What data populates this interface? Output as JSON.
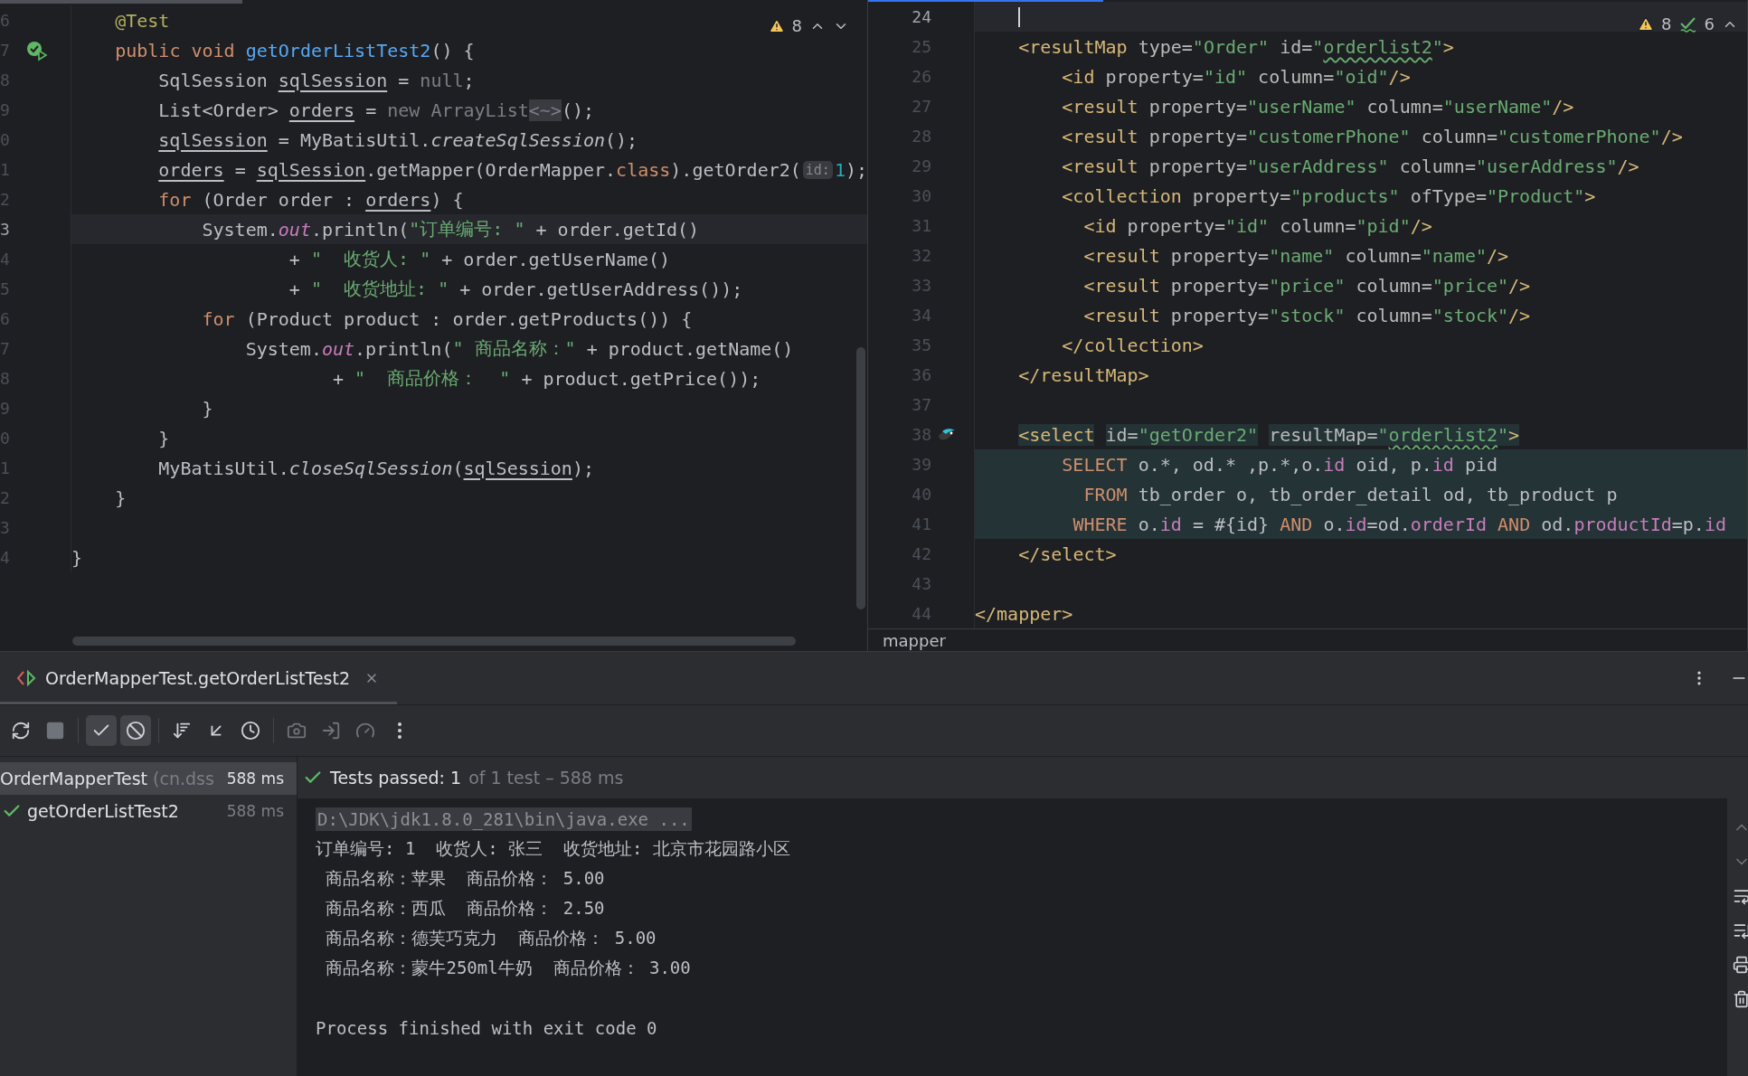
{
  "left_editor": {
    "focused": false,
    "inspections": {
      "warnings": "8"
    },
    "lines": [
      {
        "number": "6",
        "current": false,
        "tokens": [
          {
            "text": "    @Test",
            "kind": "annotation"
          }
        ]
      },
      {
        "number": "7",
        "current": false,
        "gutter_icon": {
          "kind": "run"
        },
        "tokens": [
          {
            "text": "    public void ",
            "kind": "keyword"
          },
          {
            "text": "getOrderListTest2",
            "kind": "decl"
          },
          {
            "text": "() {",
            "kind": "plain"
          }
        ]
      },
      {
        "number": "8",
        "current": false,
        "tokens": [
          {
            "text": "        SqlSession ",
            "kind": "plain"
          },
          {
            "text": "sqlSession",
            "kind": "var"
          },
          {
            "text": " = ",
            "kind": "plain"
          },
          {
            "text": "null",
            "kind": "dim"
          },
          {
            "text": ";",
            "kind": "plain"
          }
        ]
      },
      {
        "number": "9",
        "current": false,
        "tokens": [
          {
            "text": "        List<Order> ",
            "kind": "plain"
          },
          {
            "text": "orders",
            "kind": "var"
          },
          {
            "text": " = ",
            "kind": "plain"
          },
          {
            "text": "new ArrayList",
            "kind": "dim"
          },
          {
            "text": "<~>",
            "kind": "diamond"
          },
          {
            "text": "();",
            "kind": "plain"
          }
        ]
      },
      {
        "number": "0",
        "current": false,
        "tokens": [
          {
            "text": "        sqlSession",
            "kind": "var"
          },
          {
            "text": " = MyBatisUtil.",
            "kind": "plain"
          },
          {
            "text": "createSqlSession",
            "kind": "italic"
          },
          {
            "text": "();",
            "kind": "plain"
          }
        ]
      },
      {
        "number": "1",
        "current": false,
        "tokens": [
          {
            "text": "        orders",
            "kind": "var"
          },
          {
            "text": " = ",
            "kind": "plain"
          },
          {
            "text": "sqlSession",
            "kind": "var"
          },
          {
            "text": ".getMapper(OrderMapper.",
            "kind": "plain"
          },
          {
            "text": "class",
            "kind": "keyword"
          },
          {
            "text": ").getOrder2(",
            "kind": "plain"
          },
          {
            "text": "id:",
            "kind": "hint"
          },
          {
            "text": "1",
            "kind": "number"
          },
          {
            "text": ");",
            "kind": "plain"
          }
        ]
      },
      {
        "number": "2",
        "current": false,
        "tokens": [
          {
            "text": "        for",
            "kind": "keyword"
          },
          {
            "text": " (Order order : ",
            "kind": "plain"
          },
          {
            "text": "orders",
            "kind": "var"
          },
          {
            "text": ") {",
            "kind": "plain"
          }
        ]
      },
      {
        "number": "3",
        "current": true,
        "tokens": [
          {
            "text": "            System.",
            "kind": "plain"
          },
          {
            "text": "out",
            "kind": "field"
          },
          {
            "text": ".println(",
            "kind": "plain"
          },
          {
            "text": "\"订单编号: \"",
            "kind": "string"
          },
          {
            "text": " + order.getId()",
            "kind": "plain"
          }
        ]
      },
      {
        "number": "4",
        "current": false,
        "tokens": [
          {
            "text": "                    + ",
            "kind": "plain"
          },
          {
            "text": "\"  收货人: \"",
            "kind": "string"
          },
          {
            "text": " + order.getUserName()",
            "kind": "plain"
          }
        ]
      },
      {
        "number": "5",
        "current": false,
        "tokens": [
          {
            "text": "                    + ",
            "kind": "plain"
          },
          {
            "text": "\"  收货地址: \"",
            "kind": "string"
          },
          {
            "text": " + order.getUserAddress());",
            "kind": "plain"
          }
        ]
      },
      {
        "number": "6",
        "current": false,
        "tokens": [
          {
            "text": "            for",
            "kind": "keyword"
          },
          {
            "text": " (Product product : order.getProducts()) {",
            "kind": "plain"
          }
        ]
      },
      {
        "number": "7",
        "current": false,
        "tokens": [
          {
            "text": "                System.",
            "kind": "plain"
          },
          {
            "text": "out",
            "kind": "field"
          },
          {
            "text": ".println(",
            "kind": "plain"
          },
          {
            "text": "\" 商品名称：\"",
            "kind": "string"
          },
          {
            "text": " + product.getName()",
            "kind": "plain"
          }
        ]
      },
      {
        "number": "8",
        "current": false,
        "tokens": [
          {
            "text": "                        + ",
            "kind": "plain"
          },
          {
            "text": "\"  商品价格：  \"",
            "kind": "string"
          },
          {
            "text": " + product.getPrice());",
            "kind": "plain"
          }
        ]
      },
      {
        "number": "9",
        "current": false,
        "tokens": [
          {
            "text": "            }",
            "kind": "plain"
          }
        ]
      },
      {
        "number": "0",
        "current": false,
        "tokens": [
          {
            "text": "        }",
            "kind": "plain"
          }
        ]
      },
      {
        "number": "1",
        "current": false,
        "tokens": [
          {
            "text": "        MyBatisUtil.",
            "kind": "plain"
          },
          {
            "text": "closeSqlSession",
            "kind": "italic"
          },
          {
            "text": "(",
            "kind": "plain"
          },
          {
            "text": "sqlSession",
            "kind": "var"
          },
          {
            "text": ");",
            "kind": "plain"
          }
        ]
      },
      {
        "number": "2",
        "current": false,
        "tokens": [
          {
            "text": "    }",
            "kind": "plain"
          }
        ]
      },
      {
        "number": "3"
      },
      {
        "number": "4",
        "current": false,
        "tokens": [
          {
            "text": "}",
            "kind": "plain"
          }
        ]
      }
    ]
  },
  "right_editor": {
    "focused": true,
    "inspections": {
      "warnings": "8",
      "checks": "6"
    },
    "lines": [
      {
        "number": "24",
        "current": true,
        "injected": false
      },
      {
        "number": "25",
        "current": false,
        "injected": false,
        "tokens": [
          {
            "text": "    <resultMap",
            "kind": "tag"
          },
          {
            "text": " type=",
            "kind": "attr"
          },
          {
            "text": "\"Order\"",
            "kind": "value"
          },
          {
            "text": " id=",
            "kind": "attr"
          },
          {
            "text": "\"",
            "kind": "value"
          },
          {
            "text": "orderlist2",
            "kind": "value_warn"
          },
          {
            "text": "\"",
            "kind": "value"
          },
          {
            "text": ">",
            "kind": "tag"
          }
        ]
      },
      {
        "number": "26",
        "current": false,
        "injected": false,
        "tokens": [
          {
            "text": "        <id",
            "kind": "tag"
          },
          {
            "text": " property=",
            "kind": "attr"
          },
          {
            "text": "\"id\"",
            "kind": "value"
          },
          {
            "text": " column=",
            "kind": "attr"
          },
          {
            "text": "\"oid\"",
            "kind": "value"
          },
          {
            "text": "/>",
            "kind": "tag"
          }
        ]
      },
      {
        "number": "27",
        "current": false,
        "injected": false,
        "tokens": [
          {
            "text": "        <result",
            "kind": "tag"
          },
          {
            "text": " property=",
            "kind": "attr"
          },
          {
            "text": "\"userName\"",
            "kind": "value"
          },
          {
            "text": " column=",
            "kind": "attr"
          },
          {
            "text": "\"userName\"",
            "kind": "value"
          },
          {
            "text": "/>",
            "kind": "tag"
          }
        ]
      },
      {
        "number": "28",
        "current": false,
        "injected": false,
        "tokens": [
          {
            "text": "        <result",
            "kind": "tag"
          },
          {
            "text": " property=",
            "kind": "attr"
          },
          {
            "text": "\"customerPhone\"",
            "kind": "value"
          },
          {
            "text": " column=",
            "kind": "attr"
          },
          {
            "text": "\"customerPhone\"",
            "kind": "value"
          },
          {
            "text": "/>",
            "kind": "tag"
          }
        ]
      },
      {
        "number": "29",
        "current": false,
        "injected": false,
        "tokens": [
          {
            "text": "        <result",
            "kind": "tag"
          },
          {
            "text": " property=",
            "kind": "attr"
          },
          {
            "text": "\"userAddress\"",
            "kind": "value"
          },
          {
            "text": " column=",
            "kind": "attr"
          },
          {
            "text": "\"userAddress\"",
            "kind": "value"
          },
          {
            "text": "/>",
            "kind": "tag"
          }
        ]
      },
      {
        "number": "30",
        "current": false,
        "injected": false,
        "tokens": [
          {
            "text": "        <collection",
            "kind": "tag"
          },
          {
            "text": " property=",
            "kind": "attr"
          },
          {
            "text": "\"products\"",
            "kind": "value"
          },
          {
            "text": " ofType=",
            "kind": "attr"
          },
          {
            "text": "\"Product\"",
            "kind": "value"
          },
          {
            "text": ">",
            "kind": "tag"
          }
        ]
      },
      {
        "number": "31",
        "current": false,
        "injected": false,
        "tokens": [
          {
            "text": "          <id",
            "kind": "tag"
          },
          {
            "text": " property=",
            "kind": "attr"
          },
          {
            "text": "\"id\"",
            "kind": "value"
          },
          {
            "text": " column=",
            "kind": "attr"
          },
          {
            "text": "\"pid\"",
            "kind": "value"
          },
          {
            "text": "/>",
            "kind": "tag"
          }
        ]
      },
      {
        "number": "32",
        "current": false,
        "injected": false,
        "tokens": [
          {
            "text": "          <result",
            "kind": "tag"
          },
          {
            "text": " property=",
            "kind": "attr"
          },
          {
            "text": "\"name\"",
            "kind": "value"
          },
          {
            "text": " column=",
            "kind": "attr"
          },
          {
            "text": "\"name\"",
            "kind": "value"
          },
          {
            "text": "/>",
            "kind": "tag"
          }
        ]
      },
      {
        "number": "33",
        "current": false,
        "injected": false,
        "tokens": [
          {
            "text": "          <result",
            "kind": "tag"
          },
          {
            "text": " property=",
            "kind": "attr"
          },
          {
            "text": "\"price\"",
            "kind": "value"
          },
          {
            "text": " column=",
            "kind": "attr"
          },
          {
            "text": "\"price\"",
            "kind": "value"
          },
          {
            "text": "/>",
            "kind": "tag"
          }
        ]
      },
      {
        "number": "34",
        "current": false,
        "injected": false,
        "tokens": [
          {
            "text": "          <result",
            "kind": "tag"
          },
          {
            "text": " property=",
            "kind": "attr"
          },
          {
            "text": "\"stock\"",
            "kind": "value"
          },
          {
            "text": " column=",
            "kind": "attr"
          },
          {
            "text": "\"stock\"",
            "kind": "value"
          },
          {
            "text": "/>",
            "kind": "tag"
          }
        ]
      },
      {
        "number": "35",
        "current": false,
        "injected": false,
        "tokens": [
          {
            "text": "        </collection>",
            "kind": "tag"
          }
        ]
      },
      {
        "number": "36",
        "current": false,
        "injected": false,
        "tokens": [
          {
            "text": "    </resultMap>",
            "kind": "tag"
          }
        ]
      },
      {
        "number": "37"
      },
      {
        "number": "38",
        "current": false,
        "injected": false,
        "gutter_icon": {
          "kind": "bird"
        },
        "tokens": [
          {
            "text": "    <select",
            "kind": "tag_inj"
          },
          {
            "text": " id=",
            "kind": "attr_inj"
          },
          {
            "text": "\"getOrder2\"",
            "kind": "value_inj"
          },
          {
            "text": " resultMap=",
            "kind": "attr_inj"
          },
          {
            "text": "\"",
            "kind": "value_inj"
          },
          {
            "text": "orderlist2",
            "kind": "value_warn_inj"
          },
          {
            "text": "\"",
            "kind": "value_inj"
          },
          {
            "text": ">",
            "kind": "tag_inj"
          }
        ]
      },
      {
        "number": "39",
        "current": false,
        "injected": true,
        "tokens": [
          {
            "text": "        SELECT",
            "kind": "sql_kw"
          },
          {
            "text": " o.*, od.* ,p.*,o.",
            "kind": "plain"
          },
          {
            "text": "id",
            "kind": "sql_col"
          },
          {
            "text": " oid, p.",
            "kind": "plain"
          },
          {
            "text": "id",
            "kind": "sql_col"
          },
          {
            "text": " pid",
            "kind": "plain"
          }
        ]
      },
      {
        "number": "40",
        "current": false,
        "injected": true,
        "tokens": [
          {
            "text": "          FROM",
            "kind": "sql_kw"
          },
          {
            "text": " tb_order o, tb_order_detail od, tb_product p",
            "kind": "plain"
          }
        ]
      },
      {
        "number": "41",
        "current": false,
        "injected": true,
        "tokens": [
          {
            "text": "         WHERE",
            "kind": "sql_kw"
          },
          {
            "text": " o.",
            "kind": "plain"
          },
          {
            "text": "id",
            "kind": "sql_col"
          },
          {
            "text": " = #{id} ",
            "kind": "plain"
          },
          {
            "text": "AND",
            "kind": "sql_kw"
          },
          {
            "text": " o.",
            "kind": "plain"
          },
          {
            "text": "id",
            "kind": "sql_col"
          },
          {
            "text": "=od.",
            "kind": "plain"
          },
          {
            "text": "orderId",
            "kind": "sql_col"
          },
          {
            "text": " AND",
            "kind": "sql_kw"
          },
          {
            "text": " od.",
            "kind": "plain"
          },
          {
            "text": "productId",
            "kind": "sql_col"
          },
          {
            "text": "=p.",
            "kind": "plain"
          },
          {
            "text": "id",
            "kind": "sql_col"
          }
        ]
      },
      {
        "number": "42",
        "current": false,
        "injected": false,
        "tokens": [
          {
            "text": "    </select>",
            "kind": "tag"
          }
        ]
      },
      {
        "number": "43"
      },
      {
        "number": "44",
        "current": false,
        "injected": false,
        "tokens": [
          {
            "text": "</mapper>",
            "kind": "tag"
          }
        ]
      }
    ],
    "breadcrumb": "mapper"
  },
  "run_panel": {
    "tab": {
      "label": "OrderMapperTest.getOrderListTest2",
      "selected": true
    },
    "toolbar": [
      {
        "kind": "rerun",
        "pressed": false,
        "disabled": false
      },
      {
        "kind": "stop",
        "pressed": false,
        "disabled": true
      },
      {
        "kind": "show_passed",
        "pressed": true,
        "disabled": false
      },
      {
        "kind": "show_ignored",
        "pressed": true,
        "disabled": false
      },
      {
        "kind": "sort",
        "pressed": false,
        "disabled": false
      },
      {
        "kind": "import",
        "pressed": false,
        "disabled": false
      },
      {
        "kind": "history",
        "pressed": false,
        "disabled": false
      },
      {
        "kind": "snapshot",
        "pressed": false,
        "disabled": true
      },
      {
        "kind": "export",
        "pressed": false,
        "disabled": true
      },
      {
        "kind": "coverage",
        "pressed": false,
        "disabled": true
      },
      {
        "kind": "more",
        "pressed": false,
        "disabled": false
      }
    ],
    "tree": {
      "label": "OrderMapperTest",
      "package": "(cn.dss",
      "time": "588 ms",
      "selected": true,
      "children": [
        {
          "label": "getOrderListTest2",
          "time": "588 ms",
          "passed": true,
          "selected": false
        }
      ]
    },
    "summary": {
      "passed": true,
      "title": "Tests passed: 1",
      "detail": "of 1 test – 588 ms"
    },
    "console": [
      {
        "kind": "command",
        "text": "D:\\JDK\\jdk1.8.0_281\\bin\\java.exe ..."
      },
      {
        "kind": "output",
        "text": "订单编号: 1  收货人: 张三  收货地址: 北京市花园路小区"
      },
      {
        "kind": "output",
        "text": " 商品名称：苹果  商品价格： 5.00"
      },
      {
        "kind": "output",
        "text": " 商品名称：西瓜  商品价格： 2.50"
      },
      {
        "kind": "output",
        "text": " 商品名称：德芙巧克力  商品价格： 5.00"
      },
      {
        "kind": "output",
        "text": " 商品名称：蒙牛250ml牛奶  商品价格： 3.00"
      },
      {
        "kind": "blank"
      },
      {
        "kind": "output",
        "text": "Process finished with exit code 0"
      }
    ]
  }
}
